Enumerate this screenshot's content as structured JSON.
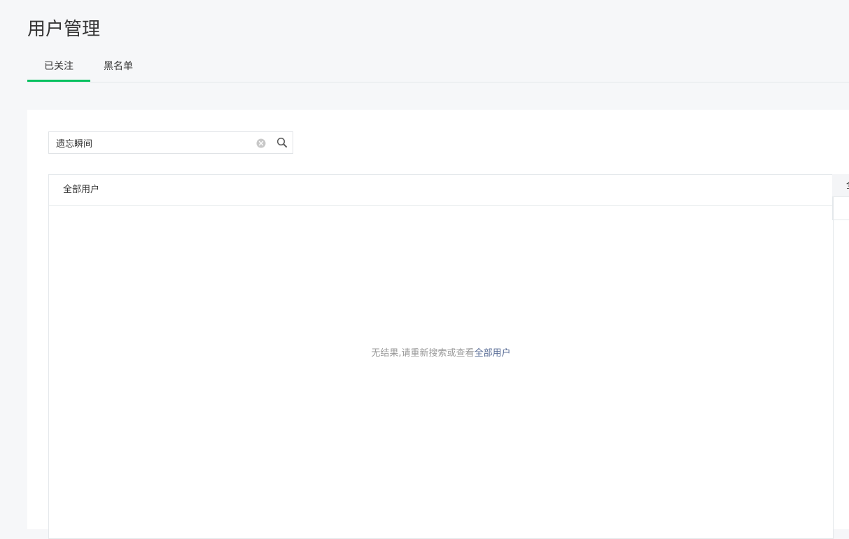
{
  "page": {
    "title": "用户管理"
  },
  "tabs": [
    {
      "label": "已关注",
      "active": true
    },
    {
      "label": "黑名单",
      "active": false
    }
  ],
  "search": {
    "value": "遗忘瞬间",
    "clear_icon": "clear-circle-icon",
    "search_icon": "magnifier-icon"
  },
  "list": {
    "header": "全部用户",
    "empty_text": "无结果,请重新搜索或查看",
    "empty_link": "全部用户"
  },
  "side": {
    "header": "全"
  },
  "colors": {
    "accent": "#07c160",
    "link": "#576b95",
    "muted": "#9a9a9a"
  }
}
